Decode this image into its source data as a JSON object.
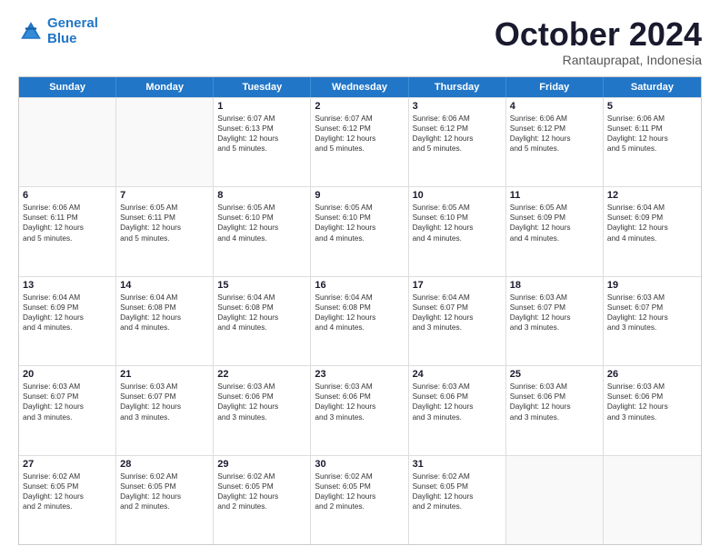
{
  "logo": {
    "line1": "General",
    "line2": "Blue"
  },
  "header": {
    "month": "October 2024",
    "location": "Rantauprapat, Indonesia"
  },
  "weekdays": [
    "Sunday",
    "Monday",
    "Tuesday",
    "Wednesday",
    "Thursday",
    "Friday",
    "Saturday"
  ],
  "rows": [
    [
      {
        "day": "",
        "lines": []
      },
      {
        "day": "",
        "lines": []
      },
      {
        "day": "1",
        "lines": [
          "Sunrise: 6:07 AM",
          "Sunset: 6:13 PM",
          "Daylight: 12 hours",
          "and 5 minutes."
        ]
      },
      {
        "day": "2",
        "lines": [
          "Sunrise: 6:07 AM",
          "Sunset: 6:12 PM",
          "Daylight: 12 hours",
          "and 5 minutes."
        ]
      },
      {
        "day": "3",
        "lines": [
          "Sunrise: 6:06 AM",
          "Sunset: 6:12 PM",
          "Daylight: 12 hours",
          "and 5 minutes."
        ]
      },
      {
        "day": "4",
        "lines": [
          "Sunrise: 6:06 AM",
          "Sunset: 6:12 PM",
          "Daylight: 12 hours",
          "and 5 minutes."
        ]
      },
      {
        "day": "5",
        "lines": [
          "Sunrise: 6:06 AM",
          "Sunset: 6:11 PM",
          "Daylight: 12 hours",
          "and 5 minutes."
        ]
      }
    ],
    [
      {
        "day": "6",
        "lines": [
          "Sunrise: 6:06 AM",
          "Sunset: 6:11 PM",
          "Daylight: 12 hours",
          "and 5 minutes."
        ]
      },
      {
        "day": "7",
        "lines": [
          "Sunrise: 6:05 AM",
          "Sunset: 6:11 PM",
          "Daylight: 12 hours",
          "and 5 minutes."
        ]
      },
      {
        "day": "8",
        "lines": [
          "Sunrise: 6:05 AM",
          "Sunset: 6:10 PM",
          "Daylight: 12 hours",
          "and 4 minutes."
        ]
      },
      {
        "day": "9",
        "lines": [
          "Sunrise: 6:05 AM",
          "Sunset: 6:10 PM",
          "Daylight: 12 hours",
          "and 4 minutes."
        ]
      },
      {
        "day": "10",
        "lines": [
          "Sunrise: 6:05 AM",
          "Sunset: 6:10 PM",
          "Daylight: 12 hours",
          "and 4 minutes."
        ]
      },
      {
        "day": "11",
        "lines": [
          "Sunrise: 6:05 AM",
          "Sunset: 6:09 PM",
          "Daylight: 12 hours",
          "and 4 minutes."
        ]
      },
      {
        "day": "12",
        "lines": [
          "Sunrise: 6:04 AM",
          "Sunset: 6:09 PM",
          "Daylight: 12 hours",
          "and 4 minutes."
        ]
      }
    ],
    [
      {
        "day": "13",
        "lines": [
          "Sunrise: 6:04 AM",
          "Sunset: 6:09 PM",
          "Daylight: 12 hours",
          "and 4 minutes."
        ]
      },
      {
        "day": "14",
        "lines": [
          "Sunrise: 6:04 AM",
          "Sunset: 6:08 PM",
          "Daylight: 12 hours",
          "and 4 minutes."
        ]
      },
      {
        "day": "15",
        "lines": [
          "Sunrise: 6:04 AM",
          "Sunset: 6:08 PM",
          "Daylight: 12 hours",
          "and 4 minutes."
        ]
      },
      {
        "day": "16",
        "lines": [
          "Sunrise: 6:04 AM",
          "Sunset: 6:08 PM",
          "Daylight: 12 hours",
          "and 4 minutes."
        ]
      },
      {
        "day": "17",
        "lines": [
          "Sunrise: 6:04 AM",
          "Sunset: 6:07 PM",
          "Daylight: 12 hours",
          "and 3 minutes."
        ]
      },
      {
        "day": "18",
        "lines": [
          "Sunrise: 6:03 AM",
          "Sunset: 6:07 PM",
          "Daylight: 12 hours",
          "and 3 minutes."
        ]
      },
      {
        "day": "19",
        "lines": [
          "Sunrise: 6:03 AM",
          "Sunset: 6:07 PM",
          "Daylight: 12 hours",
          "and 3 minutes."
        ]
      }
    ],
    [
      {
        "day": "20",
        "lines": [
          "Sunrise: 6:03 AM",
          "Sunset: 6:07 PM",
          "Daylight: 12 hours",
          "and 3 minutes."
        ]
      },
      {
        "day": "21",
        "lines": [
          "Sunrise: 6:03 AM",
          "Sunset: 6:07 PM",
          "Daylight: 12 hours",
          "and 3 minutes."
        ]
      },
      {
        "day": "22",
        "lines": [
          "Sunrise: 6:03 AM",
          "Sunset: 6:06 PM",
          "Daylight: 12 hours",
          "and 3 minutes."
        ]
      },
      {
        "day": "23",
        "lines": [
          "Sunrise: 6:03 AM",
          "Sunset: 6:06 PM",
          "Daylight: 12 hours",
          "and 3 minutes."
        ]
      },
      {
        "day": "24",
        "lines": [
          "Sunrise: 6:03 AM",
          "Sunset: 6:06 PM",
          "Daylight: 12 hours",
          "and 3 minutes."
        ]
      },
      {
        "day": "25",
        "lines": [
          "Sunrise: 6:03 AM",
          "Sunset: 6:06 PM",
          "Daylight: 12 hours",
          "and 3 minutes."
        ]
      },
      {
        "day": "26",
        "lines": [
          "Sunrise: 6:03 AM",
          "Sunset: 6:06 PM",
          "Daylight: 12 hours",
          "and 3 minutes."
        ]
      }
    ],
    [
      {
        "day": "27",
        "lines": [
          "Sunrise: 6:02 AM",
          "Sunset: 6:05 PM",
          "Daylight: 12 hours",
          "and 2 minutes."
        ]
      },
      {
        "day": "28",
        "lines": [
          "Sunrise: 6:02 AM",
          "Sunset: 6:05 PM",
          "Daylight: 12 hours",
          "and 2 minutes."
        ]
      },
      {
        "day": "29",
        "lines": [
          "Sunrise: 6:02 AM",
          "Sunset: 6:05 PM",
          "Daylight: 12 hours",
          "and 2 minutes."
        ]
      },
      {
        "day": "30",
        "lines": [
          "Sunrise: 6:02 AM",
          "Sunset: 6:05 PM",
          "Daylight: 12 hours",
          "and 2 minutes."
        ]
      },
      {
        "day": "31",
        "lines": [
          "Sunrise: 6:02 AM",
          "Sunset: 6:05 PM",
          "Daylight: 12 hours",
          "and 2 minutes."
        ]
      },
      {
        "day": "",
        "lines": []
      },
      {
        "day": "",
        "lines": []
      }
    ]
  ]
}
